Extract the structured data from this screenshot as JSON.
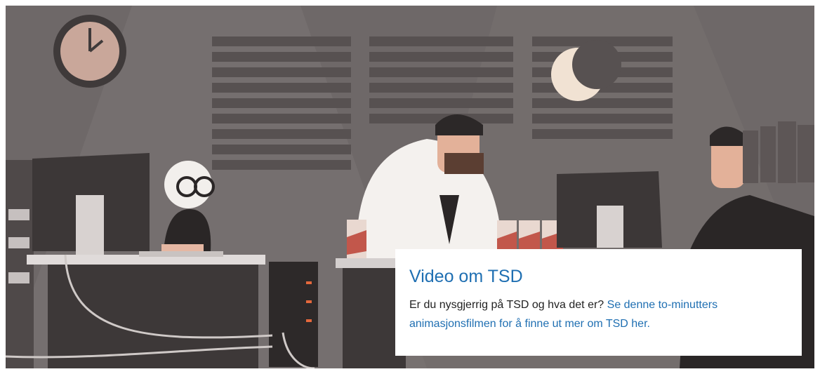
{
  "colors": {
    "wall": "#6f6969",
    "wall_dark": "#4f4a4a",
    "link": "#1f6fb2",
    "text": "#222222"
  },
  "hero": {
    "image_alt": "Animated illustration of people working at computers in a dark office"
  },
  "card": {
    "title": "Video om TSD",
    "text": "Er du nysgjerrig på TSD og hva det er? ",
    "link_text": "Se denne to-minutters animasjonsfilmen for å finne ut mer om TSD her."
  }
}
